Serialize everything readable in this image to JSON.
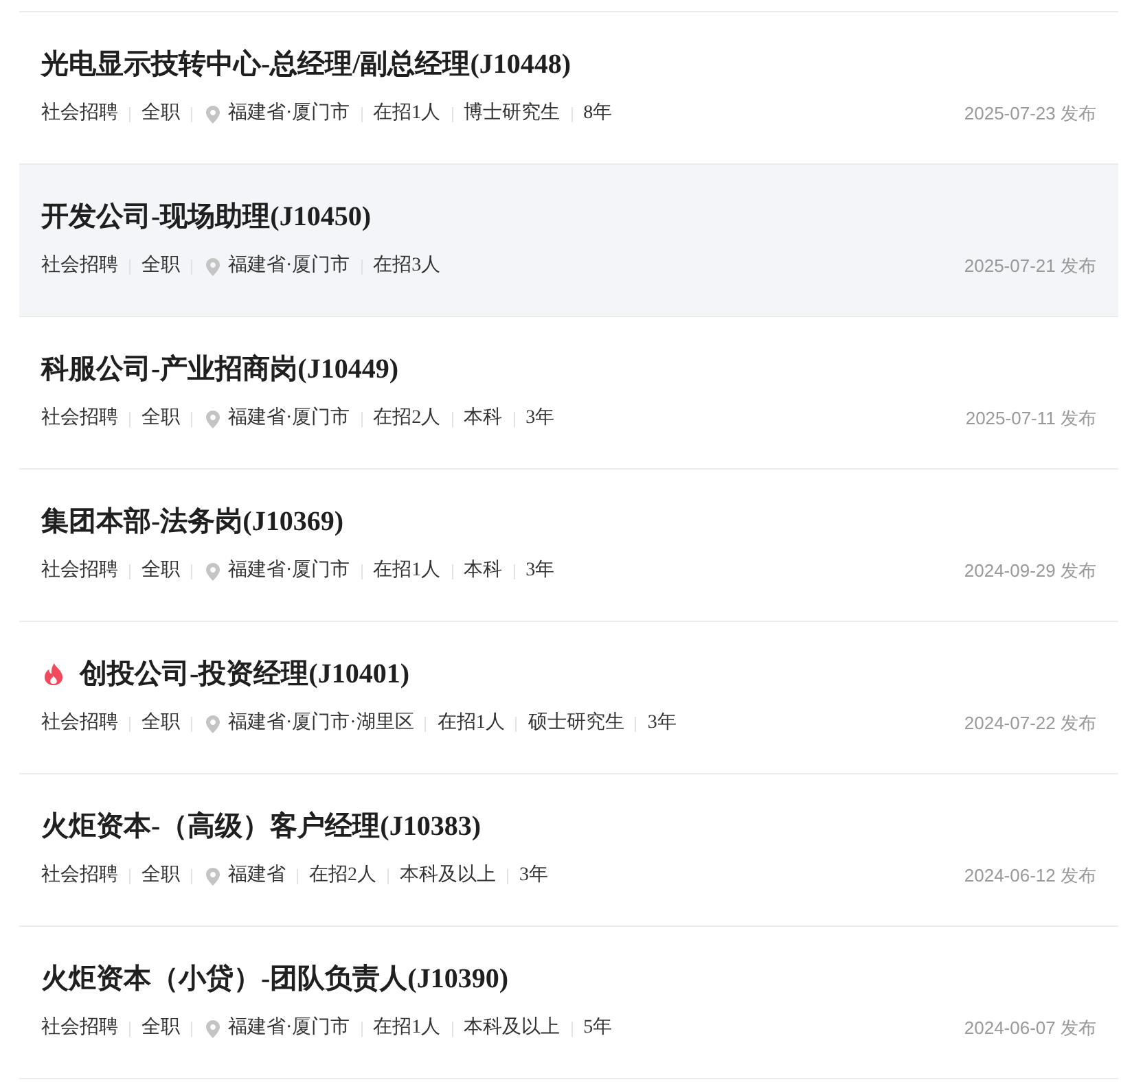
{
  "jobs": [
    {
      "title": "光电显示技转中心-总经理/副总经理(J10448)",
      "hot": false,
      "selected": false,
      "tags": [
        {
          "kind": "text",
          "text": "社会招聘"
        },
        {
          "kind": "text",
          "text": "全职"
        },
        {
          "kind": "location",
          "text": "福建省·厦门市"
        },
        {
          "kind": "text",
          "text": "在招1人"
        },
        {
          "kind": "text",
          "text": "博士研究生"
        },
        {
          "kind": "text",
          "text": "8年"
        }
      ],
      "date": "2025-07-23 发布"
    },
    {
      "title": "开发公司-现场助理(J10450)",
      "hot": false,
      "selected": true,
      "tags": [
        {
          "kind": "text",
          "text": "社会招聘"
        },
        {
          "kind": "text",
          "text": "全职"
        },
        {
          "kind": "location",
          "text": "福建省·厦门市"
        },
        {
          "kind": "text",
          "text": "在招3人"
        }
      ],
      "date": "2025-07-21 发布"
    },
    {
      "title": "科服公司-产业招商岗(J10449)",
      "hot": false,
      "selected": false,
      "tags": [
        {
          "kind": "text",
          "text": "社会招聘"
        },
        {
          "kind": "text",
          "text": "全职"
        },
        {
          "kind": "location",
          "text": "福建省·厦门市"
        },
        {
          "kind": "text",
          "text": "在招2人"
        },
        {
          "kind": "text",
          "text": "本科"
        },
        {
          "kind": "text",
          "text": "3年"
        }
      ],
      "date": "2025-07-11 发布"
    },
    {
      "title": "集团本部-法务岗(J10369)",
      "hot": false,
      "selected": false,
      "tags": [
        {
          "kind": "text",
          "text": "社会招聘"
        },
        {
          "kind": "text",
          "text": "全职"
        },
        {
          "kind": "location",
          "text": "福建省·厦门市"
        },
        {
          "kind": "text",
          "text": "在招1人"
        },
        {
          "kind": "text",
          "text": "本科"
        },
        {
          "kind": "text",
          "text": "3年"
        }
      ],
      "date": "2024-09-29 发布"
    },
    {
      "title": "创投公司-投资经理(J10401)",
      "hot": true,
      "selected": false,
      "tags": [
        {
          "kind": "text",
          "text": "社会招聘"
        },
        {
          "kind": "text",
          "text": "全职"
        },
        {
          "kind": "location",
          "text": "福建省·厦门市·湖里区"
        },
        {
          "kind": "text",
          "text": "在招1人"
        },
        {
          "kind": "text",
          "text": "硕士研究生"
        },
        {
          "kind": "text",
          "text": "3年"
        }
      ],
      "date": "2024-07-22 发布"
    },
    {
      "title": "火炬资本-（高级）客户经理(J10383)",
      "hot": false,
      "selected": false,
      "tags": [
        {
          "kind": "text",
          "text": "社会招聘"
        },
        {
          "kind": "text",
          "text": "全职"
        },
        {
          "kind": "location",
          "text": "福建省"
        },
        {
          "kind": "text",
          "text": "在招2人"
        },
        {
          "kind": "text",
          "text": "本科及以上"
        },
        {
          "kind": "text",
          "text": "3年"
        }
      ],
      "date": "2024-06-12 发布"
    },
    {
      "title": "火炬资本（小贷）-团队负责人(J10390)",
      "hot": false,
      "selected": false,
      "tags": [
        {
          "kind": "text",
          "text": "社会招聘"
        },
        {
          "kind": "text",
          "text": "全职"
        },
        {
          "kind": "location",
          "text": "福建省·厦门市"
        },
        {
          "kind": "text",
          "text": "在招1人"
        },
        {
          "kind": "text",
          "text": "本科及以上"
        },
        {
          "kind": "text",
          "text": "5年"
        }
      ],
      "date": "2024-06-07 发布"
    }
  ]
}
